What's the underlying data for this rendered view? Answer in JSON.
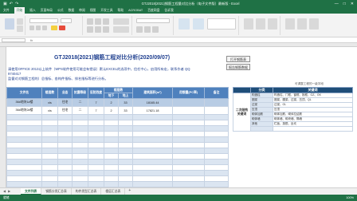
{
  "window": {
    "title": "GTJ2018(2021)钢筋工程量对比分析（电子文件版）最新版 - Excel",
    "controls": [
      "—",
      "□",
      "✕"
    ]
  },
  "ribbon": {
    "tabs": [
      "文件",
      "开始",
      "插入",
      "页面布局",
      "公式",
      "数据",
      "审阅",
      "视图",
      "开发工具",
      "帮助",
      "ACROBAT",
      "百度网盘",
      "告诉我"
    ],
    "active_index": 1
  },
  "sheet": {
    "title": "GTJ2018(2021)钢筋工程对比分析(2020/09/07)",
    "note1": "请使用OFFICE 2013以上软件（WPS软件使用可能会有错误）默认EXCEL的选项中，信任中心，启用所有宏，联系作者 QQ",
    "note2": "9740417",
    "note3": "监督对对钢筋工程的）总指标、各构件指标、排名指标等进行分析。",
    "btn_open": "打开钢筋表",
    "btn_report": "报告钢筋数据",
    "right_hint": "可调整工程的一级字段"
  },
  "left_table": {
    "headers": [
      "文件名",
      "楼层数",
      "业态",
      "抗震等级",
      "设防烈度",
      "楼层数",
      "",
      "建筑面积(m²)",
      "用钢量(PC率)",
      "备注"
    ],
    "sub_headers": [
      "地下",
      "地上"
    ],
    "rows": [
      {
        "file": "36#地块1#楼",
        "ext": "xls",
        "type": "住宅",
        "grade": "二",
        "intensity": "7",
        "under": "2",
        "above": "33",
        "area": "18165.44",
        "rate": "",
        "remark": ""
      },
      {
        "file": "36#地块2#楼",
        "ext": "xls",
        "type": "住宅",
        "grade": "二",
        "intensity": "7",
        "under": "2",
        "above": "33",
        "area": "17821.18",
        "rate": "",
        "remark": ""
      }
    ]
  },
  "right_table": {
    "headers": [
      "分类",
      "关键词"
    ],
    "group_label": "二次结构 关键词",
    "rows": [
      {
        "cat": "构造柱",
        "kw": "构造柱、门框、窗框、抱框、GZ、GK"
      },
      {
        "cat": "圈梁",
        "kw": "圈梁、腰梁、过梁、压顶、QL"
      },
      {
        "cat": "过梁",
        "kw": "过梁、GL"
      },
      {
        "cat": "压顶",
        "kw": "压顶"
      },
      {
        "cat": "砌体加筋",
        "kw": "砌体加筋、砌体拉结筋"
      },
      {
        "cat": "砌体墙",
        "kw": "砌体墙、砌块墙、隔墙"
      },
      {
        "cat": "其他",
        "kw": "栏板、挑檐、反坎"
      },
      {
        "cat": "",
        "kw": ""
      }
    ]
  },
  "tabs": {
    "items": [
      "文件列表",
      "钢筋分类汇总表",
      "构件类型汇总表",
      "楼层汇总表"
    ],
    "active_index": 0,
    "add_label": "+"
  },
  "status": {
    "ready": "就绪",
    "zoom": "100%"
  },
  "colors": {
    "excel_green": "#1f7145",
    "header_blue": "#4f81bd",
    "row_blue": "#b8cce4",
    "title_blue": "#1f3f8f"
  }
}
